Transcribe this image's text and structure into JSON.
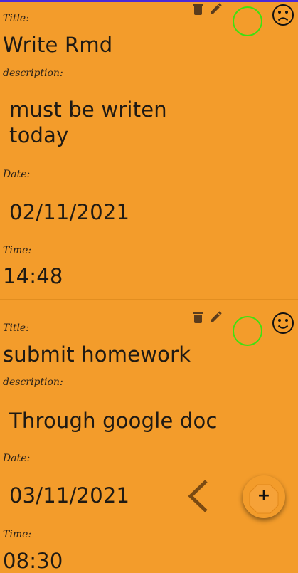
{
  "notes": [
    {
      "title_label": "Title:",
      "title": "Write Rmd",
      "description_label": "description:",
      "description": "must be writen\ntoday",
      "date_label": "Date:",
      "date": "02/11/2021",
      "time_label": "Time:",
      "time": "14:48",
      "mood_icon": "sad-face-icon"
    },
    {
      "title_label": "Title:",
      "title": "submit homework",
      "description_label": "description:",
      "description": "Through google doc",
      "date_label": "Date:",
      "date": "03/11/2021",
      "time_label": "Time:",
      "time": "08:30",
      "mood_icon": "happy-face-icon"
    }
  ],
  "fab": {
    "label": "+",
    "icon": "add-icon"
  },
  "colors": {
    "background": "#F39C2B",
    "accent_ring": "#3EE10F",
    "top_bar": "#4B2BD8"
  }
}
